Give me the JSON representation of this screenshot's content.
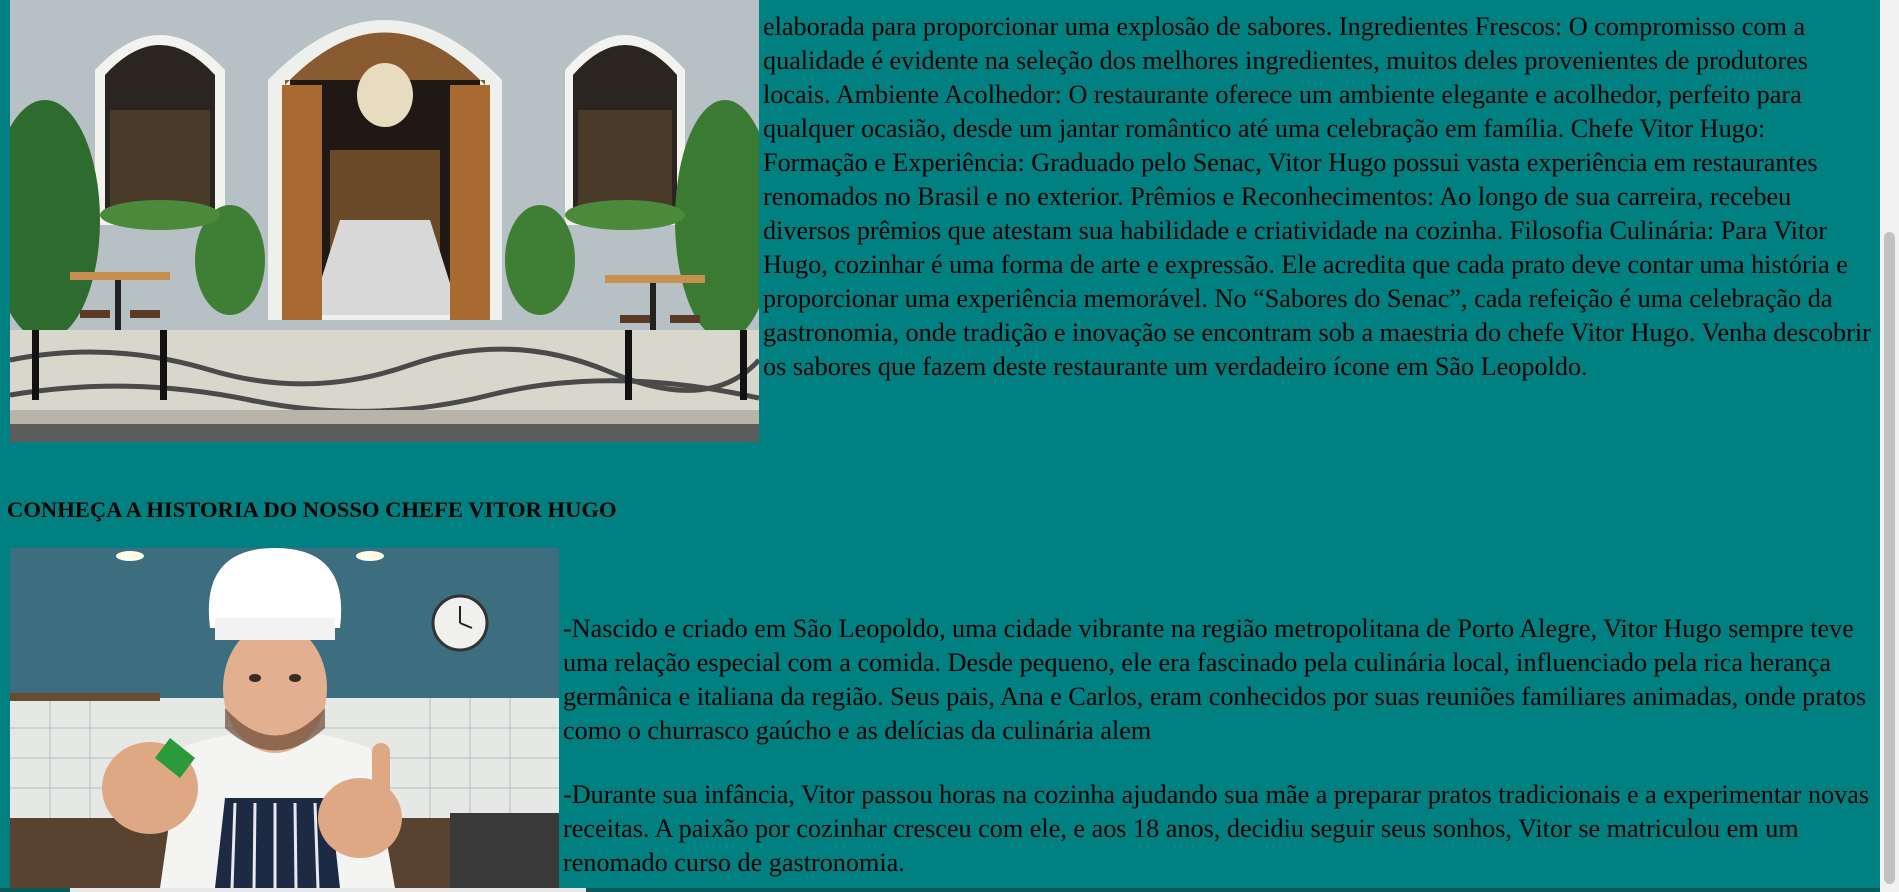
{
  "restaurant_section": {
    "image_alt": "Fachada do restaurante Sabores do Senac",
    "paragraph": "elaborada para proporcionar uma explosão de sabores. Ingredientes Frescos: O compromisso com a qualidade é evidente na seleção dos melhores ingredientes, muitos deles provenientes de produtores locais. Ambiente Acolhedor: O restaurante oferece um ambiente elegante e acolhedor, perfeito para qualquer ocasião, desde um jantar romântico até uma celebração em família. Chefe Vitor Hugo: Formação e Experiência: Graduado pelo Senac, Vitor Hugo possui vasta experiência em restaurantes renomados no Brasil e no exterior. Prêmios e Reconhecimentos: Ao longo de sua carreira, recebeu diversos prêmios que atestam sua habilidade e criatividade na cozinha. Filosofia Culinária: Para Vitor Hugo, cozinhar é uma forma de arte e expressão. Ele acredita que cada prato deve contar uma história e proporcionar uma experiência memorável. No “Sabores do Senac”, cada refeição é uma celebração da gastronomia, onde tradição e inovação se encontram sob a maestria do chefe Vitor Hugo. Venha descobrir os sabores que fazem deste restaurante um verdadeiro ícone em São Leopoldo."
  },
  "chef_section": {
    "heading": "CONHEÇA A HISTORIA DO NOSSO CHEFE VITOR HUGO",
    "image_alt": "Chefe Vitor Hugo na cozinha",
    "paragraphs": [
      "-Nascido e criado em São Leopoldo, uma cidade vibrante na região metropolitana de Porto Alegre, Vitor Hugo sempre teve uma relação especial com a comida. Desde pequeno, ele era fascinado pela culinária local, influenciado pela rica herança germânica e italiana da região. Seus pais, Ana e Carlos, eram conhecidos por suas reuniões familiares animadas, onde pratos como o churrasco gaúcho e as delícias da culinária alem",
      "-Durante sua infância, Vitor passou horas na cozinha ajudando sua mãe a preparar pratos tradicionais e a experimentar novas receitas. A paixão por cozinhar cresceu com ele, e aos 18 anos, decidiu seguir seus sonhos, Vitor se matriculou em um renomado curso de gastronomia."
    ]
  },
  "colors": {
    "page_background": "#008080",
    "text": "#000000"
  }
}
